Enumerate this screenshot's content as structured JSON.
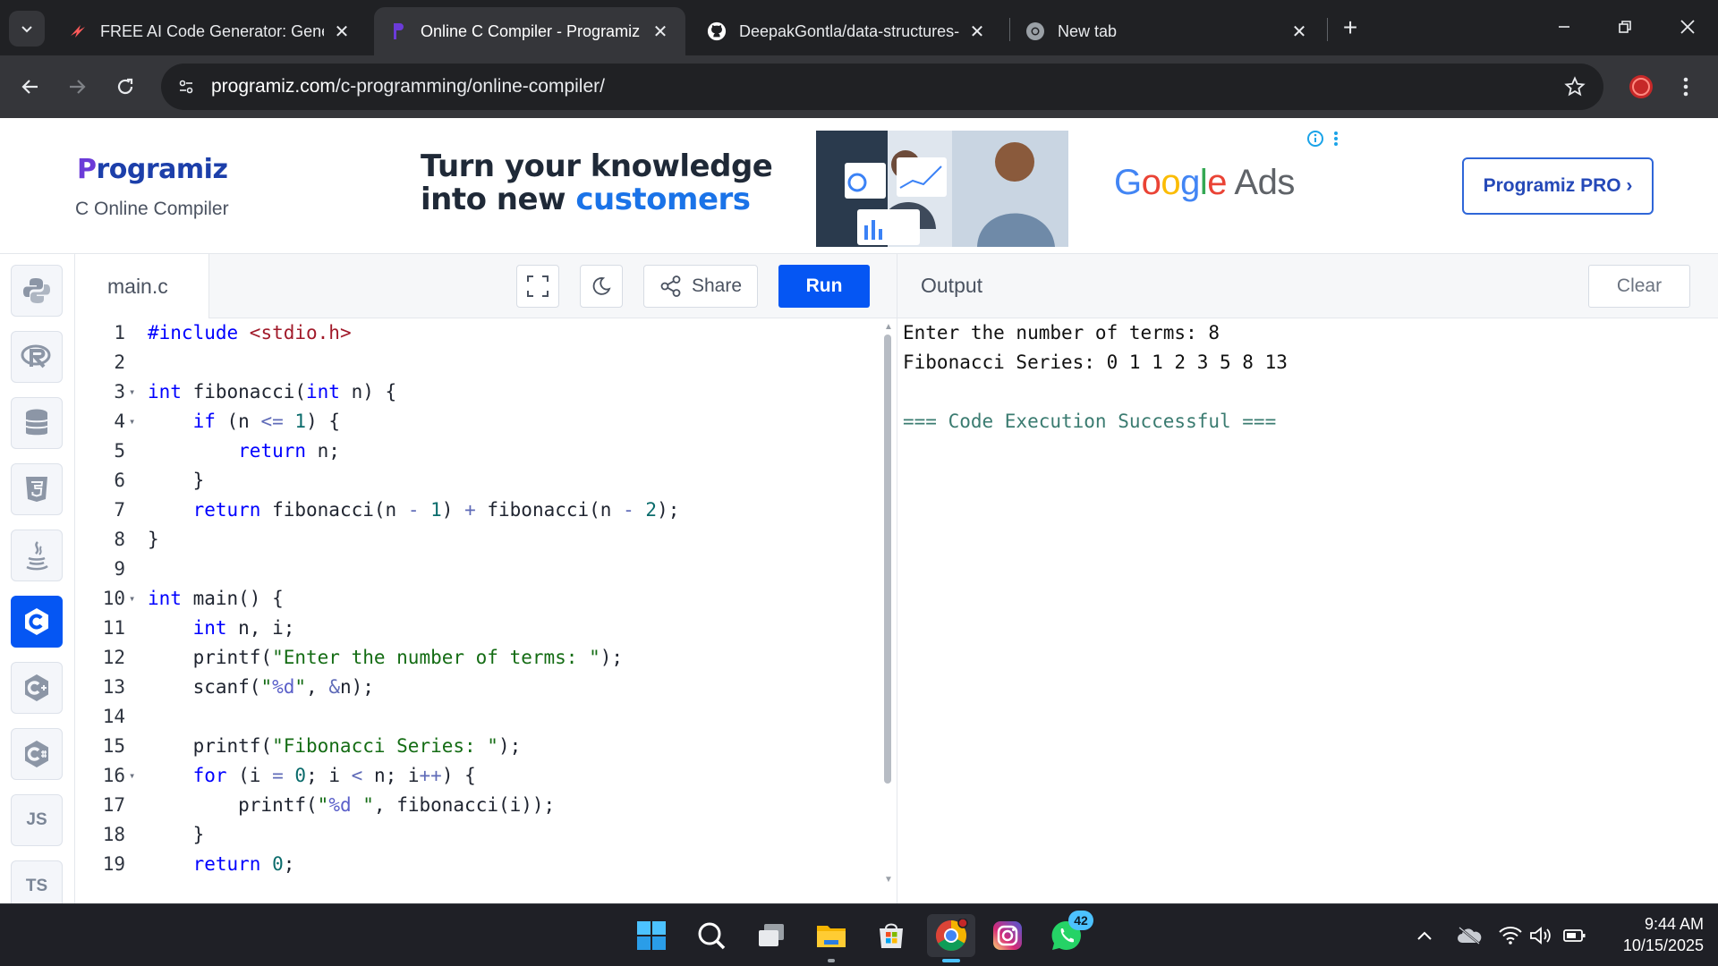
{
  "browser": {
    "tabs": [
      {
        "title": "FREE AI Code Generator: Gener",
        "active": false
      },
      {
        "title": "Online C Compiler - Programiz",
        "active": true
      },
      {
        "title": "DeepakGontla/data-structures-i",
        "active": false
      },
      {
        "title": "New tab",
        "active": false
      }
    ],
    "url_host": "programiz.com",
    "url_path": "/c-programming/online-compiler/"
  },
  "header": {
    "logo": "Programiz",
    "subtitle": "C Online Compiler",
    "ad": {
      "line1": "Turn your knowledge",
      "line2_plain": "into new ",
      "line2_accent": "customers",
      "brand": "Google Ads"
    },
    "pro_button": "Programiz PRO ›"
  },
  "rail": {
    "items": [
      "python",
      "r",
      "sql",
      "html",
      "java",
      "c",
      "cpp",
      "csharp",
      "JS",
      "TS"
    ],
    "active": "c",
    "text_labels": {
      "js": "JS",
      "ts": "TS"
    }
  },
  "editor": {
    "filename": "main.c",
    "share_label": "Share",
    "run_label": "Run",
    "lines": [
      "#include <stdio.h>",
      "",
      "int fibonacci(int n) {",
      "    if (n <= 1) {",
      "        return n;",
      "    }",
      "    return fibonacci(n - 1) + fibonacci(n - 2);",
      "}",
      "",
      "int main() {",
      "    int n, i;",
      "    printf(\"Enter the number of terms: \");",
      "    scanf(\"%d\", &n);",
      "",
      "    printf(\"Fibonacci Series: \");",
      "    for (i = 0; i < n; i++) {",
      "        printf(\"%d \", fibonacci(i));",
      "    }",
      "    return 0;"
    ],
    "line_numbers": [
      "1",
      "2",
      "3",
      "4",
      "5",
      "6",
      "7",
      "8",
      "9",
      "10",
      "11",
      "12",
      "13",
      "14",
      "15",
      "16",
      "17",
      "18",
      "19"
    ],
    "fold_lines": [
      3,
      4,
      10,
      16
    ]
  },
  "output": {
    "title": "Output",
    "clear_label": "Clear",
    "lines": [
      "Enter the number of terms: 8",
      "Fibonacci Series: 0 1 1 2 3 5 8 13",
      "",
      "=== Code Execution Successful ==="
    ]
  },
  "taskbar": {
    "apps": [
      "windows-start",
      "search",
      "task-view",
      "file-explorer",
      "microsoft-store",
      "chrome",
      "instagram",
      "whatsapp"
    ],
    "whatsapp_badge": "42",
    "time": "9:44 AM",
    "date": "10/15/2025"
  },
  "colors": {
    "accent": "#0556f3",
    "browser_dark": "#202124",
    "browser_toolbar": "#35363a",
    "success_text": "#3a7b70"
  }
}
